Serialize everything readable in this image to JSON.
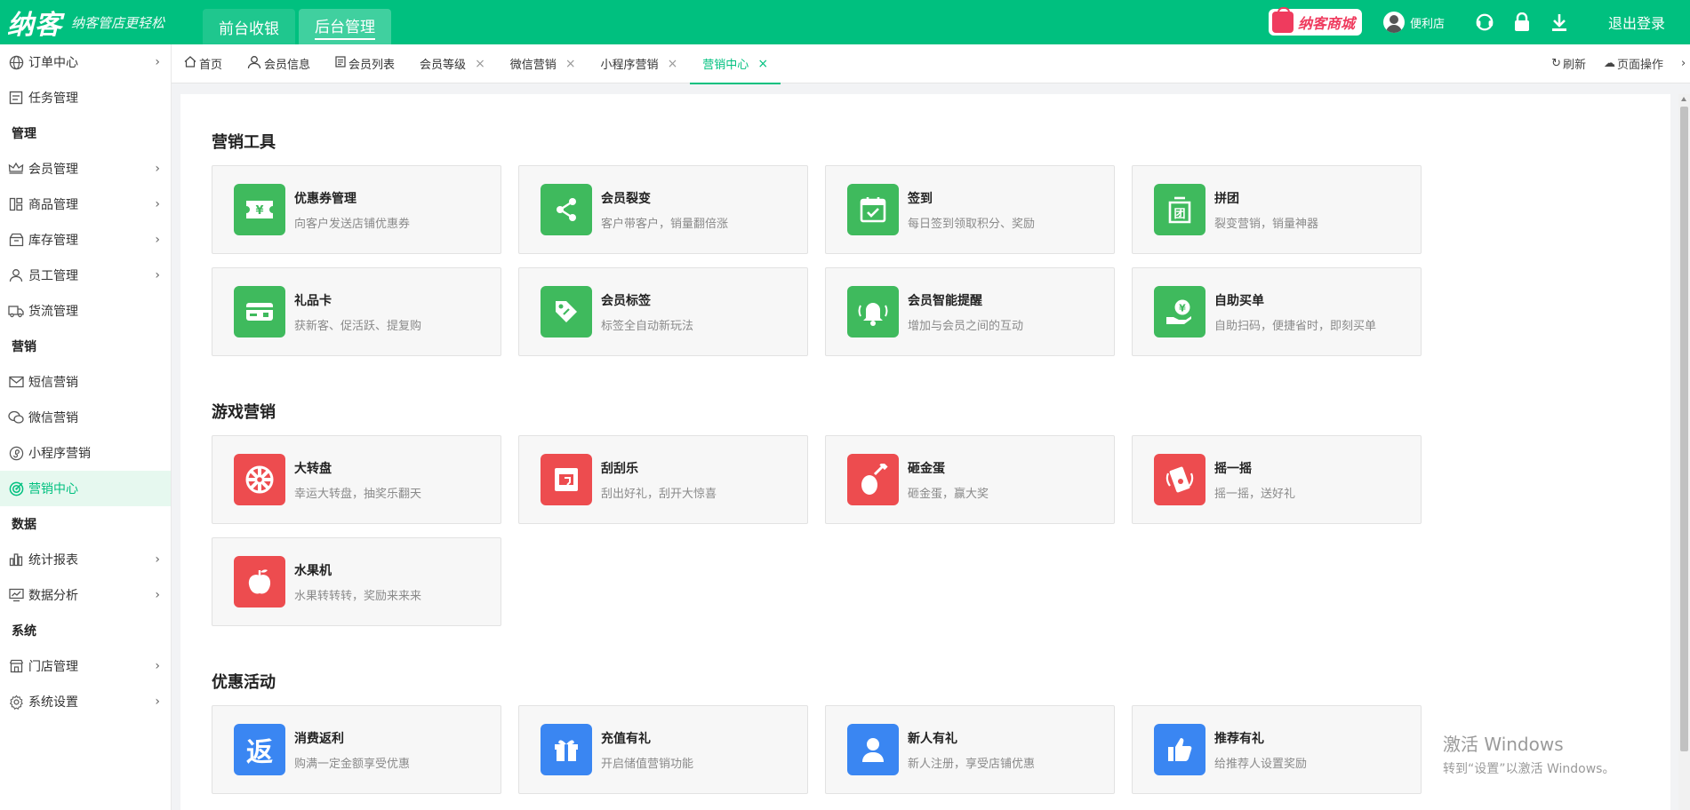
{
  "header": {
    "logo": "纳客",
    "slogan": "纳客管店更轻松",
    "tabs": [
      {
        "label": "前台收银"
      },
      {
        "label": "后台管理"
      }
    ],
    "mall": "纳客商城",
    "shop": "便利店",
    "logout": "退出登录"
  },
  "sidebar": {
    "items": [
      {
        "label": "订单中心",
        "icon": "globe-icon",
        "type": "item",
        "arrow": true
      },
      {
        "label": "任务管理",
        "icon": "task-icon",
        "type": "item",
        "arrow": false
      },
      {
        "label": "管理",
        "type": "group"
      },
      {
        "label": "会员管理",
        "icon": "crown-icon",
        "type": "item",
        "arrow": true
      },
      {
        "label": "商品管理",
        "icon": "goods-icon",
        "type": "item",
        "arrow": true
      },
      {
        "label": "库存管理",
        "icon": "inventory-icon",
        "type": "item",
        "arrow": true
      },
      {
        "label": "员工管理",
        "icon": "user-icon",
        "type": "item",
        "arrow": true
      },
      {
        "label": "货流管理",
        "icon": "truck-icon",
        "type": "item",
        "arrow": false
      },
      {
        "label": "营销",
        "type": "group"
      },
      {
        "label": "短信营销",
        "icon": "mail-icon",
        "type": "item",
        "arrow": false
      },
      {
        "label": "微信营销",
        "icon": "wechat-icon",
        "type": "item",
        "arrow": false
      },
      {
        "label": "小程序营销",
        "icon": "mini-program-icon",
        "type": "item",
        "arrow": false
      },
      {
        "label": "营销中心",
        "icon": "target-icon",
        "type": "item",
        "arrow": false,
        "active": true
      },
      {
        "label": "数据",
        "type": "group"
      },
      {
        "label": "统计报表",
        "icon": "bar-chart-icon",
        "type": "item",
        "arrow": true
      },
      {
        "label": "数据分析",
        "icon": "analysis-icon",
        "type": "item",
        "arrow": true
      },
      {
        "label": "系统",
        "type": "group"
      },
      {
        "label": "门店管理",
        "icon": "store-icon",
        "type": "item",
        "arrow": true
      },
      {
        "label": "系统设置",
        "icon": "gear-icon",
        "type": "item",
        "arrow": true
      }
    ]
  },
  "tabs": {
    "items": [
      {
        "label": "首页",
        "icon": "home-icon",
        "closable": false
      },
      {
        "label": "会员信息",
        "icon": "user-icon",
        "closable": false
      },
      {
        "label": "会员列表",
        "icon": "list-icon",
        "closable": false
      },
      {
        "label": "会员等级",
        "closable": true
      },
      {
        "label": "微信营销",
        "closable": true
      },
      {
        "label": "小程序营销",
        "closable": true
      },
      {
        "label": "营销中心",
        "closable": true,
        "active": true
      }
    ],
    "refresh": "刷新",
    "page_ops": "页面操作"
  },
  "sections": [
    {
      "title": "营销工具",
      "color": "green",
      "cards": [
        {
          "title": "优惠券管理",
          "desc": "向客户发送店铺优惠券",
          "icon": "coupon-icon"
        },
        {
          "title": "会员裂变",
          "desc": "客户带客户，销量翻倍涨",
          "icon": "share-icon"
        },
        {
          "title": "签到",
          "desc": "每日签到领取积分、奖励",
          "icon": "calendar-check-icon"
        },
        {
          "title": "拼团",
          "desc": "裂变营销，销量神器",
          "icon": "group-buy-icon"
        },
        {
          "title": "礼品卡",
          "desc": "获新客、促活跃、提复购",
          "icon": "gift-card-icon"
        },
        {
          "title": "会员标签",
          "desc": "标签全自动新玩法",
          "icon": "tag-icon"
        },
        {
          "title": "会员智能提醒",
          "desc": "增加与会员之间的互动",
          "icon": "bell-icon"
        },
        {
          "title": "自助买单",
          "desc": "自助扫码，便捷省时，即刻买单",
          "icon": "self-pay-icon"
        }
      ]
    },
    {
      "title": "游戏营销",
      "color": "red",
      "cards": [
        {
          "title": "大转盘",
          "desc": "幸运大转盘，抽奖乐翻天",
          "icon": "wheel-icon"
        },
        {
          "title": "刮刮乐",
          "desc": "刮出好礼，刮开大惊喜",
          "icon": "scratch-card-icon"
        },
        {
          "title": "砸金蛋",
          "desc": "砸金蛋，赢大奖",
          "icon": "golden-egg-icon"
        },
        {
          "title": "摇一摇",
          "desc": "摇一摇，送好礼",
          "icon": "shake-icon"
        },
        {
          "title": "水果机",
          "desc": "水果转转转，奖励来来来",
          "icon": "fruit-icon"
        }
      ]
    },
    {
      "title": "优惠活动",
      "color": "blue",
      "cards": [
        {
          "title": "消费返利",
          "desc": "购满一定金额享受优惠",
          "icon": "rebate-icon",
          "glyph": "返"
        },
        {
          "title": "充值有礼",
          "desc": "开启储值营销功能",
          "icon": "gift-icon"
        },
        {
          "title": "新人有礼",
          "desc": "新人注册，享受店铺优惠",
          "icon": "new-user-icon"
        },
        {
          "title": "推荐有礼",
          "desc": "给推荐人设置奖励",
          "icon": "thumbs-up-icon"
        }
      ]
    }
  ],
  "watermark": {
    "line1": "激活 Windows",
    "line2": "转到“设置”以激活 Windows。"
  },
  "colors": {
    "brand": "#00c07f",
    "green_icon": "#3fba5d",
    "red_icon": "#ed4c4f",
    "blue_icon": "#3a86f2"
  }
}
